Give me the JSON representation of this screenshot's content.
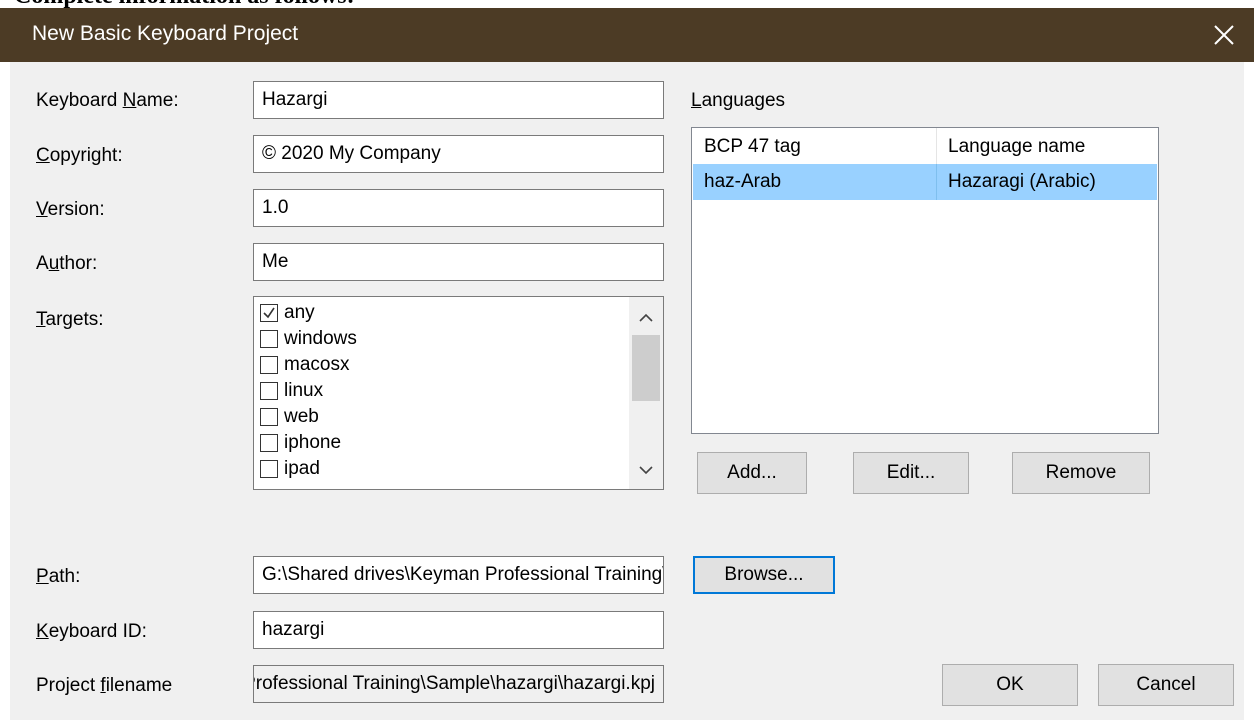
{
  "doc": {
    "fragment": "Complete information as follows:"
  },
  "dialog": {
    "title": "New Basic Keyboard Project"
  },
  "form": {
    "keyboard_name": {
      "label_pre": "Keyboard ",
      "label_ul": "N",
      "label_post": "ame:",
      "value": "Hazargi"
    },
    "copyright": {
      "label_pre": "",
      "label_ul": "C",
      "label_post": "opyright:",
      "value": "© 2020 My Company"
    },
    "version": {
      "label_pre": "",
      "label_ul": "V",
      "label_post": "ersion:",
      "value": "1.0"
    },
    "author": {
      "label_pre": "A",
      "label_ul": "u",
      "label_post": "thor:",
      "value": "Me"
    },
    "targets": {
      "label_pre": "",
      "label_ul": "T",
      "label_post": "argets:",
      "items": [
        {
          "label": "any",
          "checked": true
        },
        {
          "label": "windows",
          "checked": false
        },
        {
          "label": "macosx",
          "checked": false
        },
        {
          "label": "linux",
          "checked": false
        },
        {
          "label": "web",
          "checked": false
        },
        {
          "label": "iphone",
          "checked": false
        },
        {
          "label": "ipad",
          "checked": false
        }
      ]
    },
    "path": {
      "label_pre": "",
      "label_ul": "P",
      "label_post": "ath:",
      "value": "G:\\Shared drives\\Keyman Professional Training\\Sample"
    },
    "keyboard_id": {
      "label_pre": "",
      "label_ul": "K",
      "label_post": "eyboard ID:",
      "value": "hazargi"
    },
    "project_filename": {
      "label_pre": "Project ",
      "label_ul": "f",
      "label_post": "ilename",
      "value": "es\\Keyman Professional Training\\Sample\\hazargi\\hazargi.kpj"
    }
  },
  "languages": {
    "label_pre": "",
    "label_ul": "L",
    "label_post": "anguages",
    "columns": [
      "BCP 47 tag",
      "Language name"
    ],
    "rows": [
      {
        "tag": "haz-Arab",
        "name": "Hazaragi (Arabic)"
      }
    ]
  },
  "buttons": {
    "add": "Add...",
    "edit": "Edit...",
    "remove": "Remove",
    "browse": "Browse...",
    "ok": "OK",
    "cancel": "Cancel"
  },
  "colors": {
    "titlebar": "#4c3b25",
    "selection": "#99d1ff",
    "focus": "#0078d7"
  }
}
